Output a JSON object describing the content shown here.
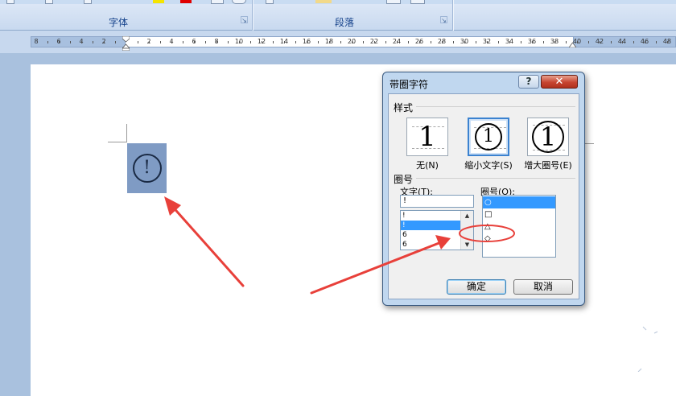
{
  "ribbon": {
    "groups": [
      {
        "label": "字体"
      },
      {
        "label": "段落"
      }
    ],
    "accent_colors": {
      "highlight": "#f5e400",
      "font_color": "#e00000"
    }
  },
  "ruler": {
    "numbers": [
      "8",
      "6",
      "4",
      "2",
      "2",
      "4",
      "6",
      "8",
      "10",
      "12",
      "14",
      "16",
      "18",
      "20",
      "22",
      "24",
      "26",
      "28",
      "30",
      "32",
      "34",
      "36",
      "38",
      "40",
      "42",
      "44",
      "46",
      "48"
    ]
  },
  "document": {
    "enclosed_char": "!"
  },
  "dialog": {
    "title": "带圈字符",
    "help_label": "?",
    "close_label": "✕",
    "style_section": "样式",
    "styles": [
      {
        "caption": "无(N)",
        "glyph": "1"
      },
      {
        "caption": "缩小文字(S)",
        "glyph": "1"
      },
      {
        "caption": "增大圈号(E)",
        "glyph": "1"
      }
    ],
    "enclosure_section": "圈号",
    "text_label": "文字(T):",
    "enclosure_label": "圈号(O):",
    "text_value": "!",
    "text_list": [
      "!",
      "!",
      "6",
      "6"
    ],
    "text_list_selected": 1,
    "enclosure_list": [
      "○",
      "□",
      "△",
      "◇"
    ],
    "enclosure_list_selected": 0,
    "ok_label": "确定",
    "cancel_label": "取消"
  },
  "annotation_color": "#e8403a"
}
